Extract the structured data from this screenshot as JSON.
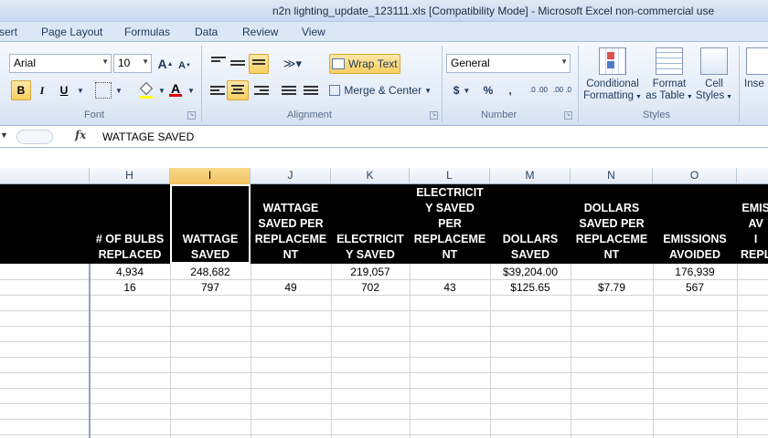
{
  "window": {
    "title": "n2n lighting_update_123111.xls  [Compatibility Mode]  -  Microsoft Excel non-commercial use"
  },
  "ribbon_tabs": [
    "sert",
    "Page Layout",
    "Formulas",
    "Data",
    "Review",
    "View"
  ],
  "font_group": {
    "font_name": "Arial",
    "font_size": "10",
    "label": "Font",
    "grow_label": "A",
    "shrink_label": "A",
    "bold": "B",
    "italic": "I",
    "underline": "U",
    "font_color_label": "A"
  },
  "alignment_group": {
    "wrap_text": "Wrap Text",
    "merge_center": "Merge & Center",
    "label": "Alignment"
  },
  "number_group": {
    "format": "General",
    "currency": "$",
    "percent": "%",
    "comma": ",",
    "inc_decimal": ".0 .00",
    "dec_decimal": ".00 .0",
    "label": "Number"
  },
  "styles_group": {
    "conditional_formatting": "Conditional\nFormatting",
    "format_as_table": "Format\nas Table",
    "cell_styles": "Cell\nStyles",
    "label": "Styles"
  },
  "cells_group": {
    "insert": "Inse"
  },
  "formula_bar": {
    "fx": "fx",
    "content": "WATTAGE SAVED"
  },
  "columns": [
    "H",
    "I",
    "J",
    "K",
    "L",
    "M",
    "N",
    "O"
  ],
  "selected_column": "I",
  "header_row": [
    "# OF BULBS\nREPLACED",
    "WATTAGE\nSAVED",
    "WATTAGE\nSAVED PER\nREPLACEME\nNT",
    "ELECTRICIT\nY SAVED",
    "ELECTRICIT\nY SAVED\nPER\nREPLACEME\nNT",
    "DOLLARS\nSAVED",
    "DOLLARS\nSAVED PER\nREPLACEME\nNT",
    "EMISSIONS\nAVOIDED",
    "EMIS\nAV\nI\nREPL"
  ],
  "data_rows": [
    [
      "4,934",
      "248,682",
      "",
      "219,057",
      "",
      "$39,204.00",
      "",
      "176,939"
    ],
    [
      "16",
      "797",
      "49",
      "702",
      "43",
      "$125.65",
      "$7.79",
      "567"
    ]
  ],
  "colors": {
    "header_fill": "#000000",
    "header_text": "#ffffff",
    "selection_highlight": "#f6cd6f",
    "ribbon_bg": "#dfe9f5"
  }
}
